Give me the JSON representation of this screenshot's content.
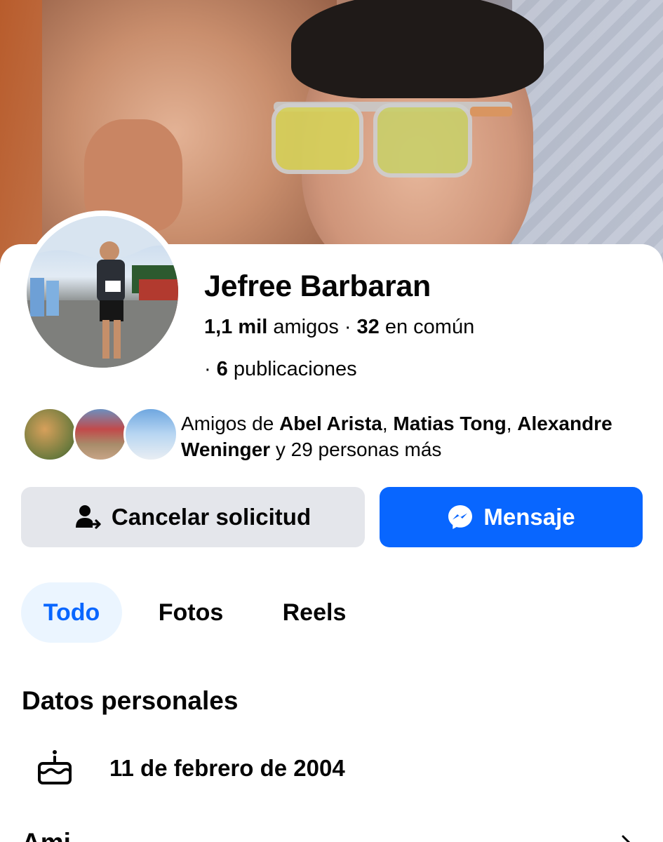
{
  "profile": {
    "name": "Jefree Barbaran",
    "friends_count": "1,1 mil",
    "friends_label": "amigos",
    "mutual_count": "32",
    "mutual_label": "en común",
    "posts_count": "6",
    "posts_label": "publicaciones"
  },
  "mutual_friends": {
    "prefix": "Amigos de",
    "friend1": "Abel Arista",
    "friend2": "Matias Tong",
    "friend3": "Alexandre Weninger",
    "connector": "y",
    "suffix": "29 personas más"
  },
  "actions": {
    "cancel_label": "Cancelar solicitud",
    "message_label": "Mensaje"
  },
  "tabs": [
    {
      "label": "Todo",
      "active": true
    },
    {
      "label": "Fotos",
      "active": false
    },
    {
      "label": "Reels",
      "active": false
    }
  ],
  "personal_data": {
    "title": "Datos personales",
    "birthday": "11 de febrero de 2004"
  },
  "next_section": {
    "title_partial": "Ami"
  },
  "colors": {
    "accent": "#0866ff",
    "tab_active_bg": "#ebf5ff",
    "secondary_button": "#e4e6eb"
  },
  "icons": {
    "cancel": "person-arrow-icon",
    "message": "messenger-icon",
    "birthday": "birthday-cake-icon"
  }
}
